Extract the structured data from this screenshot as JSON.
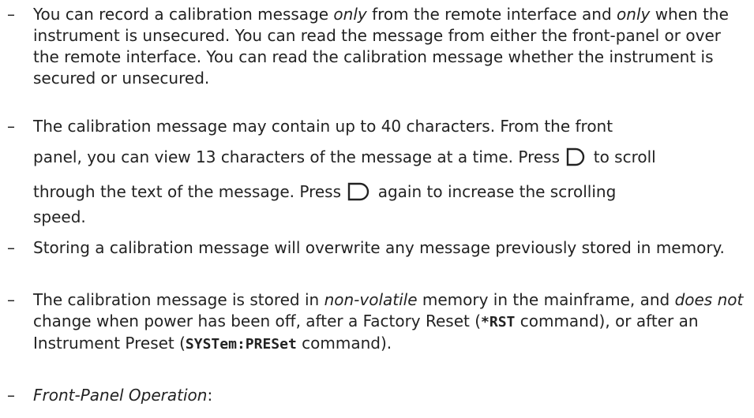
{
  "bullet_marker": "–",
  "items": [
    {
      "parts": {
        "a": "You can record a calibration message ",
        "b": "only",
        "c": " from the remote interface and ",
        "d": "only",
        "e": " when the instrument is unsecured. You can read the message from either the front-panel or over the remote interface. You can read the calibration message whether the instrument is secured or unsecured."
      }
    },
    {
      "parts": {
        "line1": "The calibration message may contain up to 40 characters. From the front",
        "line2a": "panel, you can view 13 characters of the message at a time. Press",
        "line2b": "to scroll",
        "line3a": "through the text of the message. Press",
        "line3b": "again to increase the scrolling",
        "line4": "speed."
      },
      "icon": "right-arrow-key-icon"
    },
    {
      "text": "Storing a calibration message will overwrite any message previously stored in memory."
    },
    {
      "parts": {
        "a": "The calibration message is stored in ",
        "b": "non-volatile",
        "c": " memory in the mainframe, and ",
        "d": "does not",
        "e": " change when power has been off, after a Factory Reset (",
        "f": "*RST",
        "g": " command), or after an Instrument Preset (",
        "h": "SYSTem:PRESet",
        "i": " command)."
      }
    },
    {
      "parts": {
        "a": "Front-Panel Operation",
        "b": ":"
      }
    }
  ]
}
